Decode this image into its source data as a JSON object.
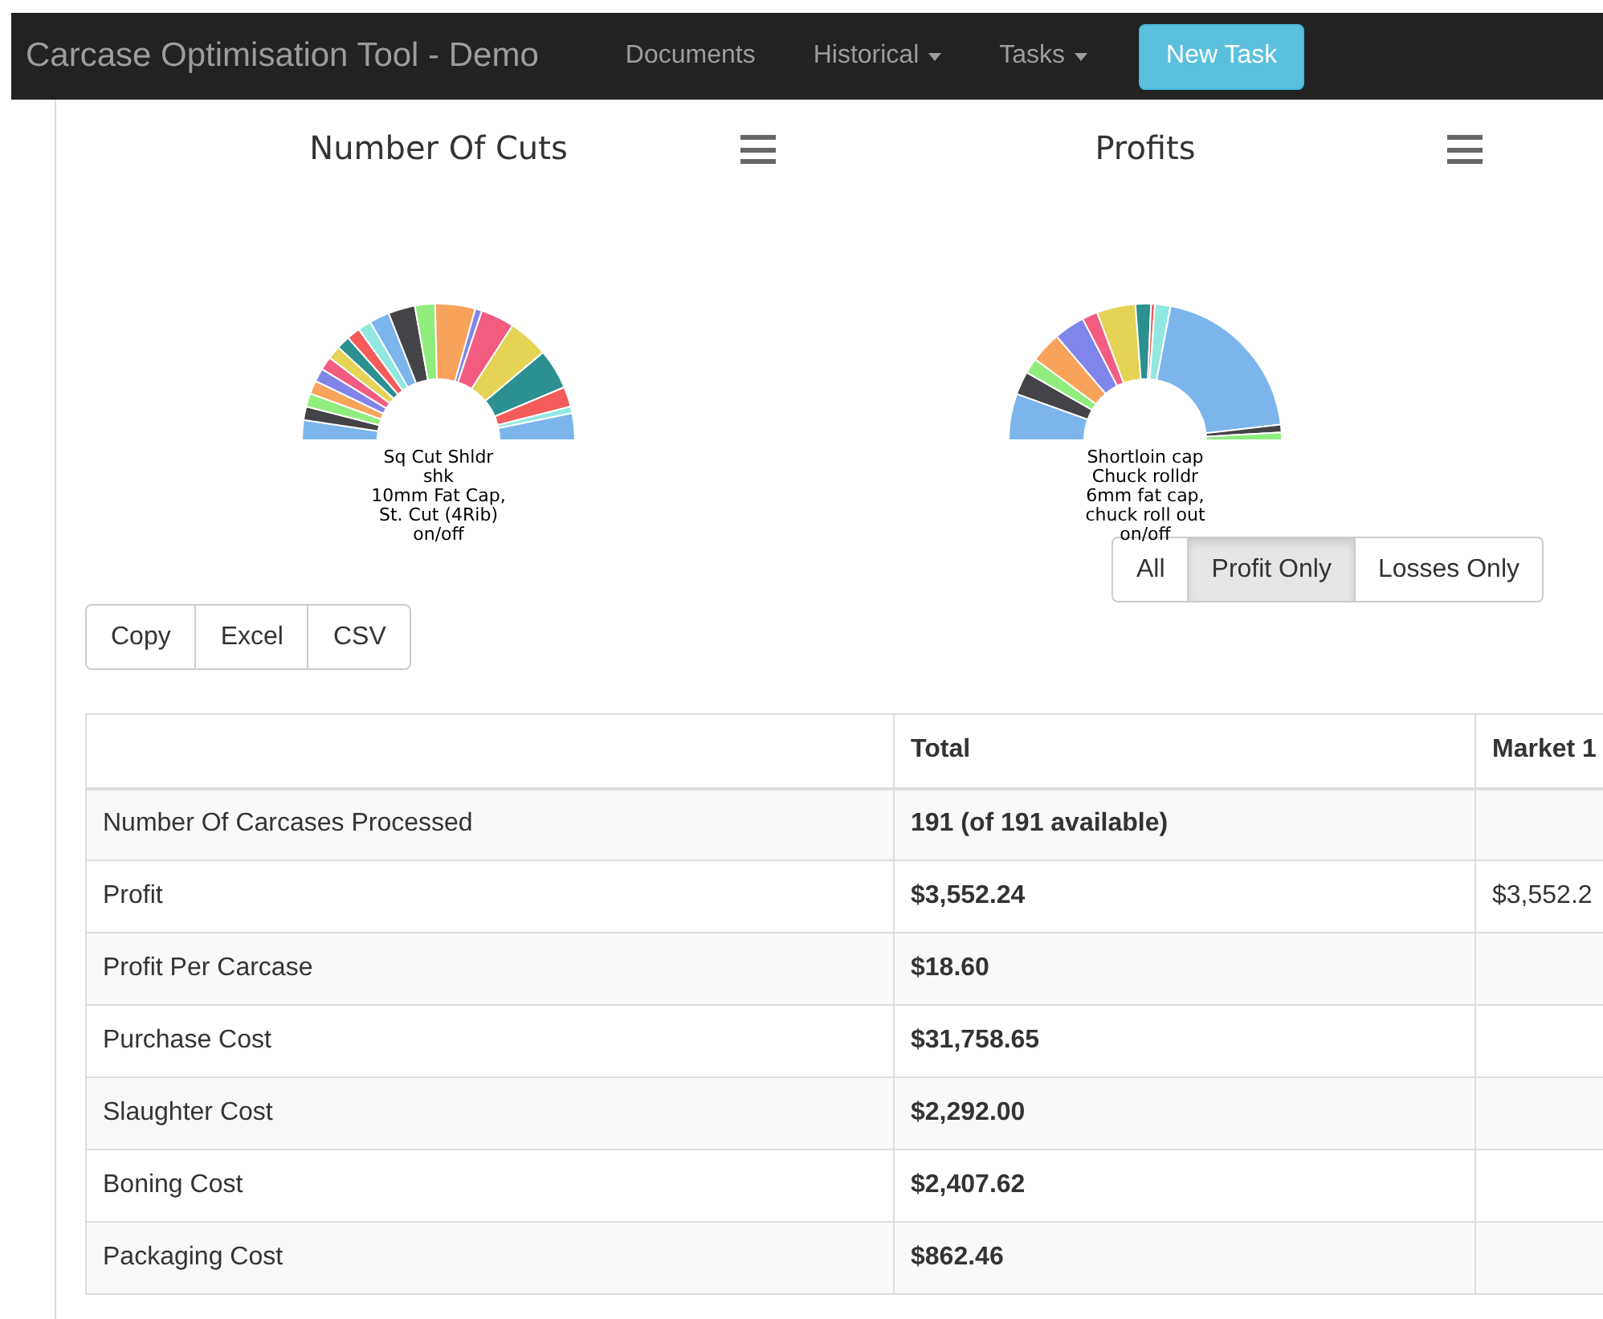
{
  "navbar": {
    "brand": "Carcase Optimisation Tool - Demo",
    "items": [
      {
        "label": "Documents",
        "dropdown": false
      },
      {
        "label": "Historical",
        "dropdown": true
      },
      {
        "label": "Tasks",
        "dropdown": true
      }
    ],
    "action_button": "New Task"
  },
  "charts": [
    {
      "title": "Number Of Cuts",
      "labels": [
        "Sq Cut Shldr",
        "shk",
        "10mm Fat Cap,",
        "St. Cut (4Rib)",
        "on/off"
      ]
    },
    {
      "title": "Profits",
      "labels": [
        "Shortloin cap",
        "Chuck rolldr",
        "6mm fat cap,",
        "chuck roll out",
        "on/off"
      ]
    }
  ],
  "filter_buttons": [
    {
      "label": "All",
      "selected": false
    },
    {
      "label": "Profit Only",
      "selected": true
    },
    {
      "label": "Losses Only",
      "selected": false
    }
  ],
  "export_buttons": [
    "Copy",
    "Excel",
    "CSV"
  ],
  "table": {
    "columns": [
      "Total",
      "Market 1"
    ],
    "rows": [
      {
        "label": "Number Of Carcases Processed",
        "total": "191 (of 191 available)"
      },
      {
        "label": "Profit",
        "total": "$3,552.24",
        "market_1": "$3,552.2"
      },
      {
        "label": "Profit Per Carcase",
        "total": "$18.60"
      },
      {
        "label": "Purchase Cost",
        "total": "$31,758.65"
      },
      {
        "label": "Slaughter Cost",
        "total": "$2,292.00"
      },
      {
        "label": "Boning Cost",
        "total": "$2,407.62"
      },
      {
        "label": "Packaging Cost",
        "total": "$862.46"
      }
    ]
  }
}
